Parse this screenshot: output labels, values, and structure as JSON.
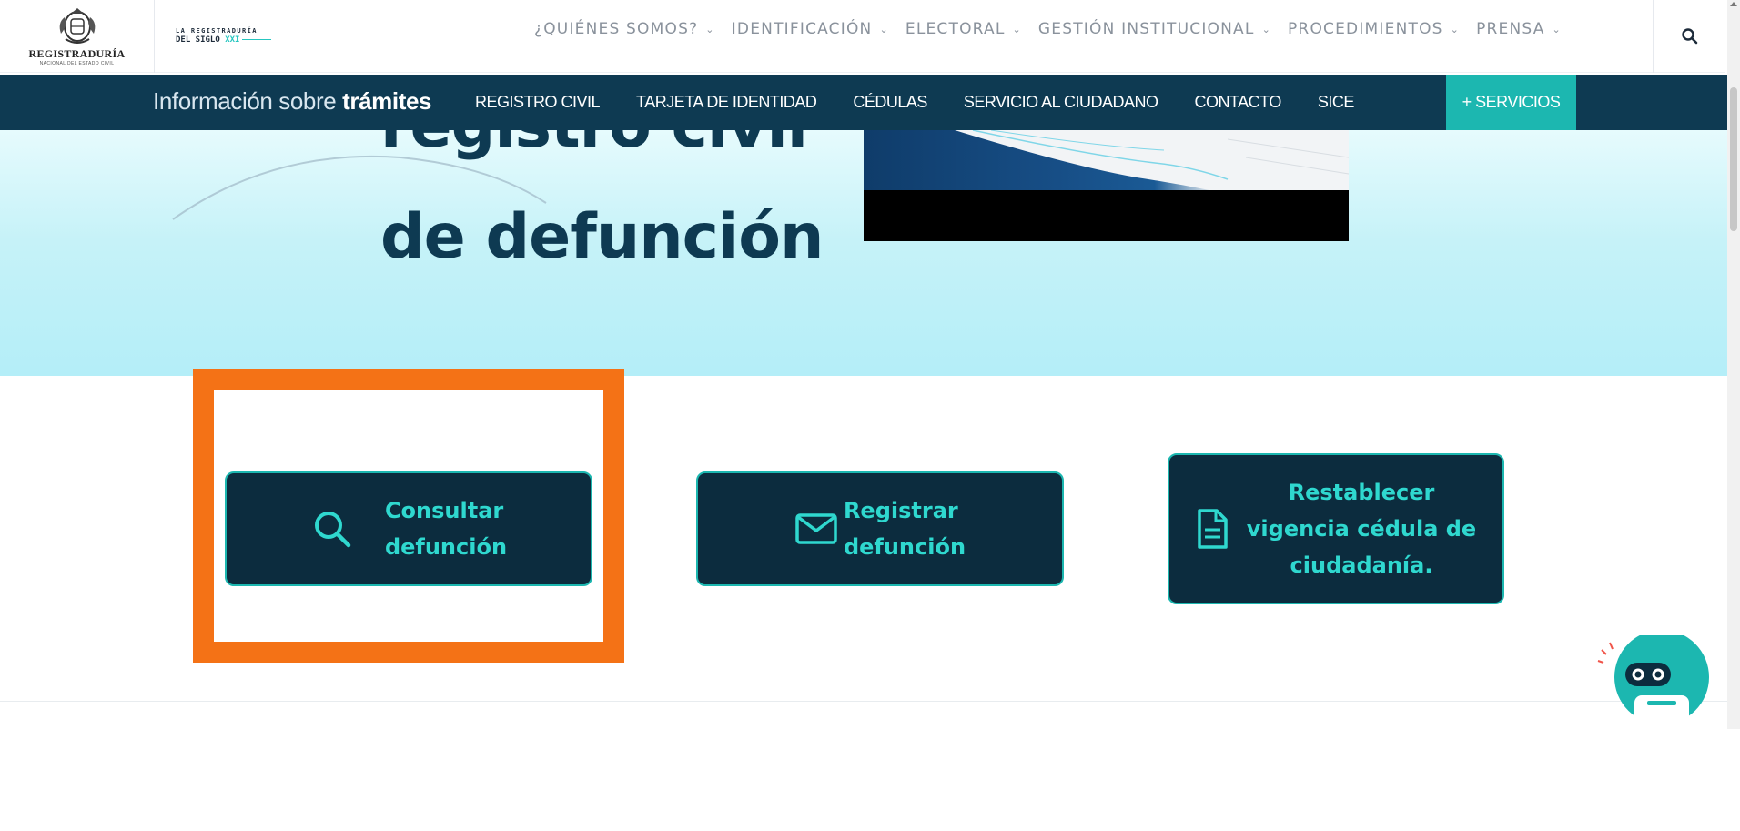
{
  "header": {
    "logo_text": "REGISTRADURÍA",
    "logo_subtext": "NACIONAL DEL ESTADO CIVIL",
    "siglo_line1": "LA REGISTRADURÍA",
    "siglo_line2": "DEL SIGLO",
    "siglo_xxi": "XXI",
    "nav": [
      {
        "label": "¿QUIÉNES SOMOS?"
      },
      {
        "label": "IDENTIFICACIÓN"
      },
      {
        "label": "ELECTORAL"
      },
      {
        "label": "GESTIÓN INSTITUCIONAL"
      },
      {
        "label": "PROCEDIMIENTOS"
      },
      {
        "label": "PRENSA"
      }
    ],
    "search_icon": "search-icon"
  },
  "subnav": {
    "title_prefix": "Información sobre ",
    "title_bold": "trámites",
    "links": [
      {
        "label": "REGISTRO CIVIL"
      },
      {
        "label": "TARJETA DE IDENTIDAD"
      },
      {
        "label": "CÉDULAS"
      },
      {
        "label": "SERVICIO AL CIUDADANO"
      },
      {
        "label": "CONTACTO"
      },
      {
        "label": "SICE"
      }
    ],
    "servicios_label": "+ SERVICIOS"
  },
  "hero": {
    "title_line1": "registro civil",
    "title_line2": "de defunción"
  },
  "actions": {
    "consultar": {
      "line1": "Consultar",
      "line2": "defunción",
      "icon": "search-icon"
    },
    "registrar": {
      "line1": "Registrar",
      "line2": "defunción",
      "icon": "envelope-icon"
    },
    "restablecer": {
      "line1": "Restablecer",
      "line2": "vigencia cédula de",
      "line3": "ciudadanía.",
      "icon": "document-icon"
    }
  },
  "colors": {
    "navy": "#0e3a52",
    "teal": "#1cb7b0",
    "button_bg": "#0c2c3e",
    "button_text": "#2fd8cf",
    "highlight": "#f47216"
  }
}
